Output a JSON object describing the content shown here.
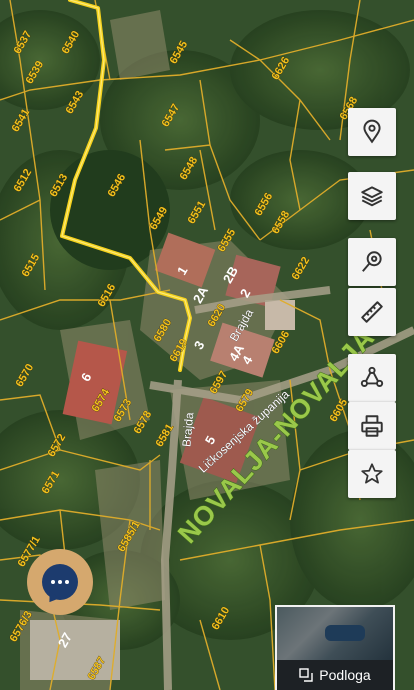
{
  "map": {
    "parcel_numbers": [
      "6537",
      "6540",
      "6545",
      "6539",
      "6541",
      "6543",
      "6547",
      "6626",
      "6512",
      "6513",
      "6546",
      "6548",
      "6549",
      "6551",
      "6515",
      "6516",
      "6556",
      "6558",
      "6555",
      "6570",
      "6574",
      "6573",
      "6578",
      "6572",
      "6571",
      "6581",
      "6605",
      "6606",
      "6577/1",
      "6576/3",
      "6585/1",
      "6587",
      "6610",
      "6597",
      "6580",
      "6579",
      "6619",
      "6622",
      "6620",
      "6568"
    ],
    "house_numbers": [
      "1",
      "2A",
      "2B",
      "2",
      "3",
      "4A",
      "4",
      "5",
      "6",
      "27"
    ],
    "street_names": [
      "Brajda",
      "Brajda",
      "Ličkosenjska županija"
    ],
    "municipality_label": "NOVALJA-NOVALJA",
    "route_color": "#f5d21c"
  },
  "toolbar": [
    {
      "name": "location-pin-icon",
      "icon": "pin"
    },
    {
      "name": "layers-icon",
      "icon": "layers"
    },
    {
      "name": "search-location-icon",
      "icon": "search-pin"
    },
    {
      "name": "ruler-icon",
      "icon": "ruler"
    },
    {
      "name": "share-icon",
      "icon": "share"
    },
    {
      "name": "printer-icon",
      "icon": "print"
    },
    {
      "name": "favorite-star-icon",
      "icon": "star"
    }
  ],
  "basemap": {
    "label": "Podloga",
    "icon": "basemap-switch-icon"
  }
}
